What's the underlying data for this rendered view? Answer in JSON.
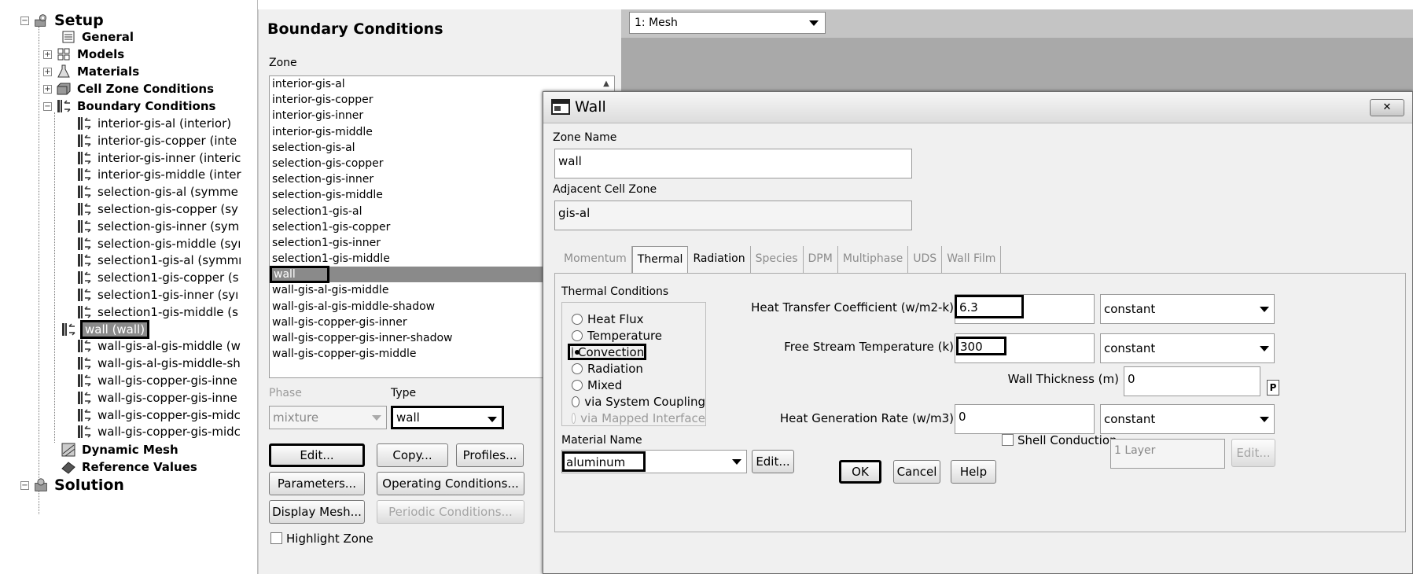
{
  "tree": {
    "setup": "Setup",
    "general": "General",
    "models": "Models",
    "materials": "Materials",
    "cell_zone": "Cell Zone Conditions",
    "boundary": "Boundary Conditions",
    "items": [
      "interior-gis-al (interior)",
      "interior-gis-copper (inte",
      "interior-gis-inner (interic",
      "interior-gis-middle (inter",
      "selection-gis-al (symme",
      "selection-gis-copper (sy",
      "selection-gis-inner (sym",
      "selection-gis-middle (syı",
      "selection1-gis-al (symmı",
      "selection1-gis-copper (s",
      "selection1-gis-inner (syı",
      "selection1-gis-middle (s",
      "wall (wall)",
      "wall-gis-al-gis-middle (w",
      "wall-gis-al-gis-middle-sh",
      "wall-gis-copper-gis-inne",
      "wall-gis-copper-gis-inne",
      "wall-gis-copper-gis-midc",
      "wall-gis-copper-gis-midc"
    ],
    "dynamic_mesh": "Dynamic Mesh",
    "reference_values": "Reference Values",
    "solution": "Solution"
  },
  "bc_panel": {
    "title": "Boundary Conditions",
    "zone_label": "Zone",
    "zones": [
      "interior-gis-al",
      "interior-gis-copper",
      "interior-gis-inner",
      "interior-gis-middle",
      "selection-gis-al",
      "selection-gis-copper",
      "selection-gis-inner",
      "selection-gis-middle",
      "selection1-gis-al",
      "selection1-gis-copper",
      "selection1-gis-inner",
      "selection1-gis-middle",
      "wall",
      "wall-gis-al-gis-middle",
      "wall-gis-al-gis-middle-shadow",
      "wall-gis-copper-gis-inner",
      "wall-gis-copper-gis-inner-shadow",
      "wall-gis-copper-gis-middle"
    ],
    "selected_zone_index": 12,
    "phase_label": "Phase",
    "phase_value": "mixture",
    "type_label": "Type",
    "type_value": "wall",
    "edit": "Edit...",
    "copy": "Copy...",
    "profiles": "Profiles...",
    "parameters": "Parameters...",
    "operating": "Operating Conditions...",
    "display_mesh": "Display Mesh...",
    "periodic": "Periodic Conditions...",
    "highlight_zone": "Highlight Zone"
  },
  "graphics": {
    "window_select": "1: Mesh"
  },
  "dialog": {
    "title": "Wall",
    "close": "✕",
    "zone_name_label": "Zone Name",
    "zone_name": "wall",
    "adjacent_label": "Adjacent Cell Zone",
    "adjacent_value": "gis-al",
    "tabs": [
      "Momentum",
      "Thermal",
      "Radiation",
      "Species",
      "DPM",
      "Multiphase",
      "UDS",
      "Wall Film"
    ],
    "active_tab": "Thermal",
    "thermal_conditions_label": "Thermal Conditions",
    "conditions": [
      "Heat Flux",
      "Temperature",
      "Convection",
      "Radiation",
      "Mixed",
      "via System Coupling",
      "via Mapped Interface"
    ],
    "selected_condition": "Convection",
    "htc_label": "Heat Transfer Coefficient (w/m2-k)",
    "htc_value": "6.3",
    "htc_method": "constant",
    "fst_label": "Free Stream Temperature (k)",
    "fst_value": "300",
    "fst_method": "constant",
    "wall_thickness_label": "Wall Thickness (m)",
    "wall_thickness_value": "0",
    "p_button": "P",
    "hgr_label": "Heat Generation Rate (w/m3)",
    "hgr_value": "0",
    "hgr_method": "constant",
    "material_label": "Material Name",
    "material_value": "aluminum",
    "material_edit": "Edit...",
    "shell_conduction": "Shell Conduction",
    "layers": "1 Layer",
    "layers_edit": "Edit...",
    "ok": "OK",
    "cancel": "Cancel",
    "help": "Help"
  }
}
